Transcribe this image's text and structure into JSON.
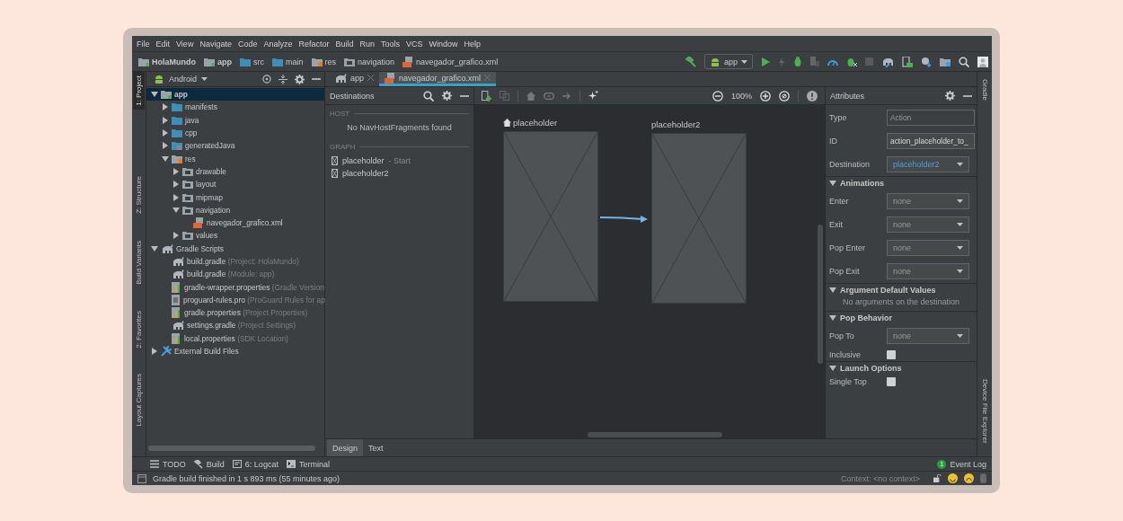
{
  "menu": [
    "File",
    "Edit",
    "View",
    "Navigate",
    "Code",
    "Analyze",
    "Refactor",
    "Build",
    "Run",
    "Tools",
    "VCS",
    "Window",
    "Help"
  ],
  "breadcrumbs": [
    {
      "label": "HolaMundo",
      "kind": "project"
    },
    {
      "label": "app",
      "kind": "module"
    },
    {
      "label": "src",
      "kind": "folder"
    },
    {
      "label": "main",
      "kind": "folder"
    },
    {
      "label": "res",
      "kind": "res"
    },
    {
      "label": "navigation",
      "kind": "resfolder"
    },
    {
      "label": "navegador_grafico.xml",
      "kind": "xml"
    }
  ],
  "run_config": "app",
  "left_tool_tabs": [
    {
      "label": "1: Project",
      "selected": true
    },
    {
      "label": "Z: Structure",
      "selected": false
    },
    {
      "label": "Build Variants",
      "selected": false
    },
    {
      "label": "2: Favorites",
      "selected": false
    },
    {
      "label": "Layout Captures",
      "selected": false
    }
  ],
  "right_tool_tabs": [
    {
      "label": "Gradle",
      "selected": false
    },
    {
      "label": "Device File Explorer",
      "selected": false
    }
  ],
  "project": {
    "view": "Android",
    "tree": [
      {
        "label": "app",
        "kind": "module",
        "expanded": true,
        "selected": true,
        "children": [
          {
            "label": "manifests",
            "kind": "folder",
            "expanded": false,
            "selected": false
          },
          {
            "label": "java",
            "kind": "folder",
            "expanded": false,
            "selected": false
          },
          {
            "label": "cpp",
            "kind": "folder",
            "expanded": false,
            "selected": false
          },
          {
            "label": "generatedJava",
            "kind": "genfolder",
            "expanded": false,
            "selected": false
          },
          {
            "label": "res",
            "kind": "res",
            "expanded": true,
            "selected": false,
            "children": [
              {
                "label": "drawable",
                "kind": "resfolder",
                "expanded": false,
                "selected": false
              },
              {
                "label": "layout",
                "kind": "resfolder",
                "expanded": false,
                "selected": false
              },
              {
                "label": "mipmap",
                "kind": "resfolder",
                "expanded": false,
                "selected": false
              },
              {
                "label": "navigation",
                "kind": "resfolder",
                "expanded": true,
                "selected": false,
                "children": [
                  {
                    "label": "navegador_grafico.xml",
                    "kind": "xml",
                    "selected": false
                  }
                ]
              },
              {
                "label": "values",
                "kind": "resfolder",
                "expanded": false,
                "selected": false
              }
            ]
          }
        ]
      },
      {
        "label": "Gradle Scripts",
        "kind": "gradle",
        "expanded": true,
        "selected": false,
        "children": [
          {
            "label": "build.gradle",
            "hint": "(Project: HolaMundo)",
            "kind": "gradle",
            "selected": false
          },
          {
            "label": "build.gradle",
            "hint": "(Module: app)",
            "kind": "gradle",
            "selected": false
          },
          {
            "label": "gradle-wrapper.properties",
            "hint": "(Gradle Version",
            "kind": "properties",
            "selected": false
          },
          {
            "label": "proguard-rules.pro",
            "hint": "(ProGuard Rules for ap",
            "kind": "text",
            "selected": false
          },
          {
            "label": "gradle.properties",
            "hint": "(Project Properties)",
            "kind": "properties",
            "selected": false
          },
          {
            "label": "settings.gradle",
            "hint": "(Project Settings)",
            "kind": "gradle",
            "selected": false
          },
          {
            "label": "local.properties",
            "hint": "(SDK Location)",
            "kind": "properties",
            "selected": false
          }
        ]
      },
      {
        "label": "External Build Files",
        "kind": "tools",
        "expanded": false,
        "selected": false
      }
    ]
  },
  "editor_tabs": [
    {
      "label": "app",
      "kind": "gradle",
      "selected": false
    },
    {
      "label": "navegador_grafico.xml",
      "kind": "xml",
      "selected": true
    }
  ],
  "destinations": {
    "title": "Destinations",
    "host": {
      "heading": "HOST",
      "empty": "No NavHostFragments found"
    },
    "graph": {
      "heading": "GRAPH",
      "items": [
        {
          "label": "placeholder",
          "note": "- Start",
          "selected": false
        },
        {
          "label": "placeholder2",
          "selected": false
        }
      ]
    }
  },
  "canvas": {
    "zoom": "100%",
    "nodes": [
      {
        "label": "placeholder",
        "start": true
      },
      {
        "label": "placeholder2",
        "start": false
      }
    ]
  },
  "attributes": {
    "title": "Attributes",
    "fields": [
      {
        "label": "Type",
        "kind": "text",
        "value": "Action",
        "disabled": true
      },
      {
        "label": "ID",
        "kind": "text",
        "value": "action_placeholder_to_",
        "disabled": false
      },
      {
        "label": "Destination",
        "kind": "dropdown",
        "value": "placeholder2"
      }
    ],
    "sections": [
      {
        "title": "Animations",
        "expanded": true,
        "rows": [
          {
            "label": "Enter",
            "kind": "dropdown",
            "placeholder": "none"
          },
          {
            "label": "Exit",
            "kind": "dropdown",
            "placeholder": "none"
          },
          {
            "label": "Pop Enter",
            "kind": "dropdown",
            "placeholder": "none"
          },
          {
            "label": "Pop Exit",
            "kind": "dropdown",
            "placeholder": "none"
          }
        ]
      },
      {
        "title": "Argument Default Values",
        "expanded": true,
        "empty": "No arguments on the destination"
      },
      {
        "title": "Pop Behavior",
        "expanded": true,
        "rows": [
          {
            "label": "Pop To",
            "kind": "dropdown",
            "placeholder": "none"
          },
          {
            "label": "Inclusive",
            "kind": "checkbox",
            "checked": false
          }
        ]
      },
      {
        "title": "Launch Options",
        "expanded": true,
        "rows": [
          {
            "label": "Single Top",
            "kind": "checkbox",
            "checked": false
          }
        ]
      }
    ]
  },
  "editor_bottom_tabs": [
    {
      "label": "Design",
      "selected": true
    },
    {
      "label": "Text",
      "selected": false
    }
  ],
  "tool_windows": [
    {
      "label": "TODO",
      "kind": "todo"
    },
    {
      "label": "Build",
      "kind": "build"
    },
    {
      "label": "6: Logcat",
      "kind": "logcat"
    },
    {
      "label": "Terminal",
      "kind": "terminal"
    }
  ],
  "event_log": {
    "label": "Event Log",
    "count": "1"
  },
  "status": {
    "message": "Gradle build finished in 1 s 893 ms (55 minutes ago)",
    "context": "Context: <no context>"
  }
}
